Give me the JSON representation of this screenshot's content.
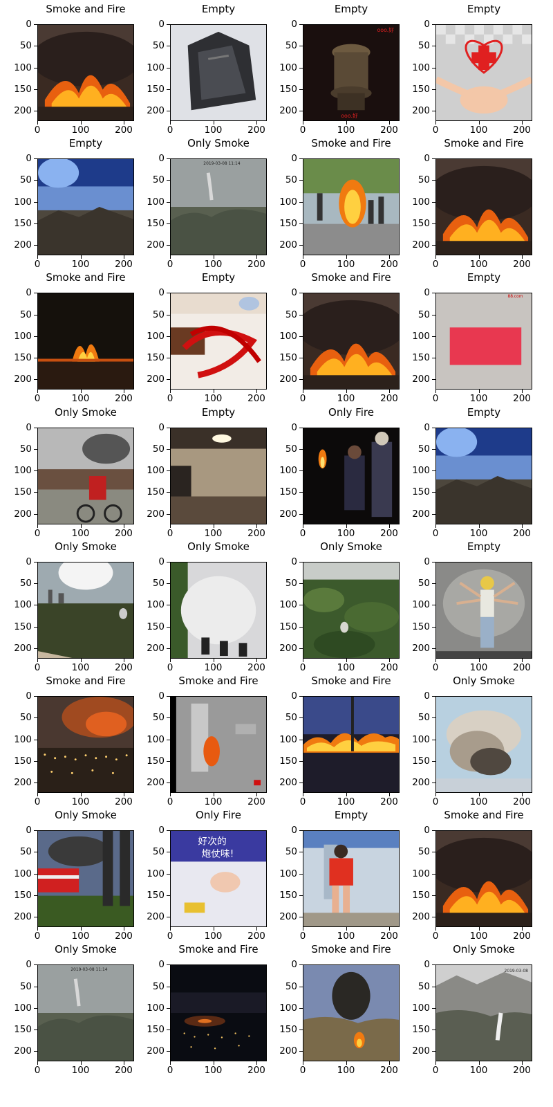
{
  "chart_data": {
    "type": "image-grid",
    "rows": 8,
    "cols": 4,
    "xticks": [
      "0",
      "100",
      "200"
    ],
    "yticks": [
      "0",
      "50",
      "100",
      "150",
      "200"
    ],
    "xlim": [
      0,
      224
    ],
    "ylim": [
      224,
      0
    ],
    "panels": [
      {
        "title": "Smoke and Fire",
        "scene": "fire-hill"
      },
      {
        "title": "Empty",
        "scene": "plastic-bag"
      },
      {
        "title": "Empty",
        "scene": "bronze-vessel"
      },
      {
        "title": "Empty",
        "scene": "heart-cross"
      },
      {
        "title": "Empty",
        "scene": "sky-mountain"
      },
      {
        "title": "Only Smoke",
        "scene": "haze-forest"
      },
      {
        "title": "Smoke and Fire",
        "scene": "crowd-fire"
      },
      {
        "title": "Smoke and Fire",
        "scene": "fire-hill"
      },
      {
        "title": "Smoke and Fire",
        "scene": "night-fire"
      },
      {
        "title": "Empty",
        "scene": "red-beads"
      },
      {
        "title": "Smoke and Fire",
        "scene": "fire-hill"
      },
      {
        "title": "Empty",
        "scene": "red-card"
      },
      {
        "title": "Only Smoke",
        "scene": "street-smoke"
      },
      {
        "title": "Empty",
        "scene": "room"
      },
      {
        "title": "Only Fire",
        "scene": "torch-dark"
      },
      {
        "title": "Empty",
        "scene": "sky-mountain"
      },
      {
        "title": "Only Smoke",
        "scene": "sun-town"
      },
      {
        "title": "Only Smoke",
        "scene": "white-smoke-crowd"
      },
      {
        "title": "Only Smoke",
        "scene": "green-forest"
      },
      {
        "title": "Empty",
        "scene": "studio-man"
      },
      {
        "title": "Smoke and Fire",
        "scene": "city-fire-night"
      },
      {
        "title": "Smoke and Fire",
        "scene": "cctv-fire"
      },
      {
        "title": "Smoke and Fire",
        "scene": "fire-evening"
      },
      {
        "title": "Only Smoke",
        "scene": "smoke-plume"
      },
      {
        "title": "Only Smoke",
        "scene": "fire-truck"
      },
      {
        "title": "Only Fire",
        "scene": "lighter"
      },
      {
        "title": "Empty",
        "scene": "red-dress"
      },
      {
        "title": "Smoke and Fire",
        "scene": "fire-hill"
      },
      {
        "title": "Only Smoke",
        "scene": "haze-forest"
      },
      {
        "title": "Smoke and Fire",
        "scene": "night-city"
      },
      {
        "title": "Smoke and Fire",
        "scene": "black-smoke-hill"
      },
      {
        "title": "Only Smoke",
        "scene": "mountain-smoke"
      }
    ]
  }
}
